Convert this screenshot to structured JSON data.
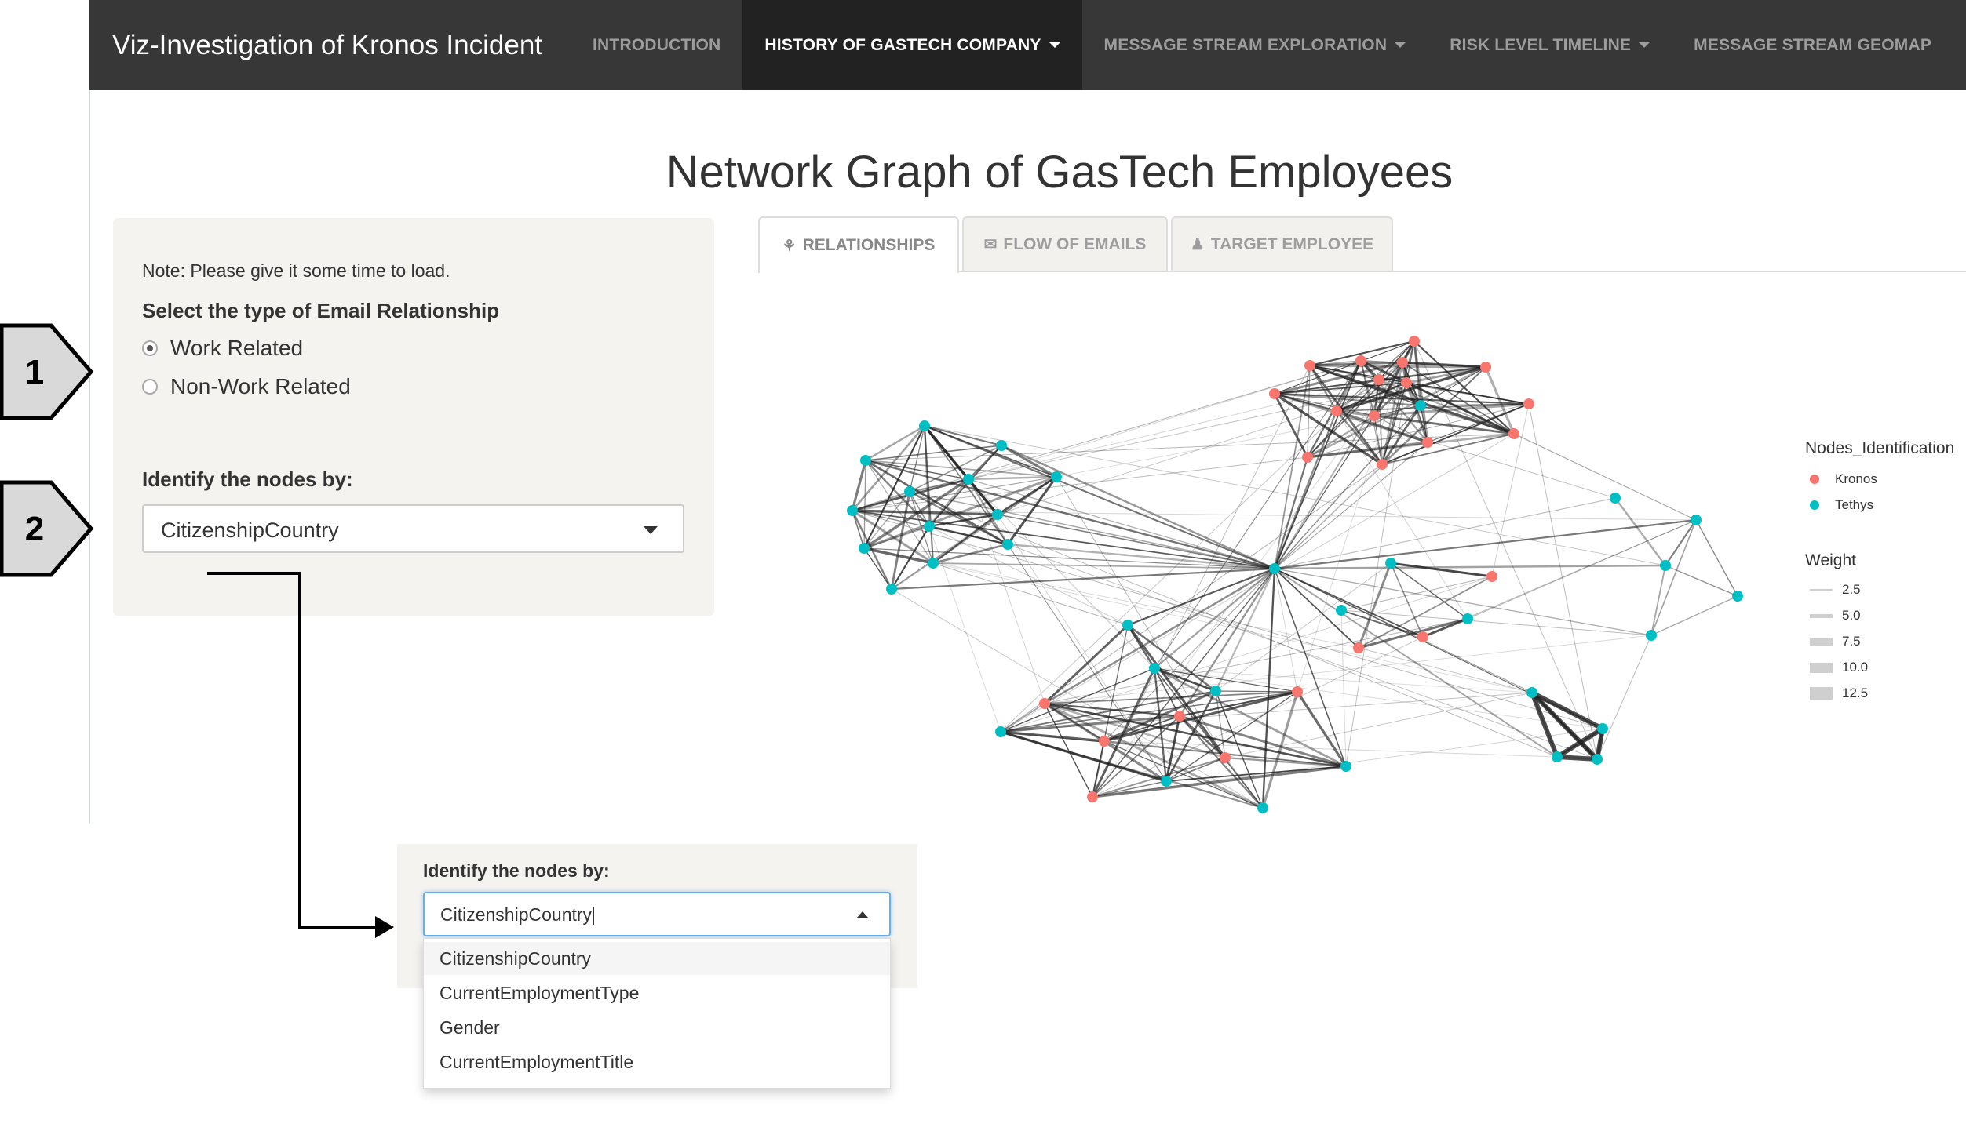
{
  "navbar": {
    "brand": "Viz-Investigation of Kronos Incident",
    "items": [
      {
        "label": "INTRODUCTION",
        "active": false,
        "dropdown": false
      },
      {
        "label": "HISTORY OF GASTECH COMPANY",
        "active": true,
        "dropdown": true
      },
      {
        "label": "MESSAGE STREAM EXPLORATION",
        "active": false,
        "dropdown": true
      },
      {
        "label": "RISK LEVEL TIMELINE",
        "active": false,
        "dropdown": true
      },
      {
        "label": "MESSAGE STREAM GEOMAP",
        "active": false,
        "dropdown": false
      }
    ]
  },
  "page_title": "Network Graph of GasTech Employees",
  "sidebar": {
    "note": "Note: Please give it some time to load.",
    "relationship_label": "Select the type of Email Relationship",
    "relationship_options": [
      "Work Related",
      "Non-Work Related"
    ],
    "relationship_selected": "Work Related",
    "identify_label": "Identify the nodes by:",
    "identify_value": "CitizenshipCountry"
  },
  "markers": {
    "first": "1",
    "second": "2"
  },
  "tabs": [
    {
      "label": "RELATIONSHIPS",
      "icon": "handshake-icon",
      "active": true
    },
    {
      "label": "FLOW OF EMAILS",
      "icon": "envelope-icon",
      "active": false
    },
    {
      "label": "TARGET EMPLOYEE",
      "icon": "users-icon",
      "active": false
    }
  ],
  "legend": {
    "nodes_title": "Nodes_Identification",
    "nodes": [
      {
        "label": "Kronos",
        "color": "#F8766D"
      },
      {
        "label": "Tethys",
        "color": "#00BFC4"
      }
    ],
    "weight_title": "Weight",
    "weights": [
      "2.5",
      "5.0",
      "7.5",
      "10.0",
      "12.5"
    ]
  },
  "zoom": {
    "label": "Identify the nodes by:",
    "value": "CitizenshipCountry",
    "options": [
      "CitizenshipCountry",
      "CurrentEmploymentType",
      "Gender",
      "CurrentEmploymentTitle"
    ],
    "selected": "CitizenshipCountry"
  },
  "colors": {
    "navbar_bg": "#373737",
    "navbar_active": "#222222",
    "kronos": "#F8766D",
    "tethys": "#00BFC4"
  }
}
